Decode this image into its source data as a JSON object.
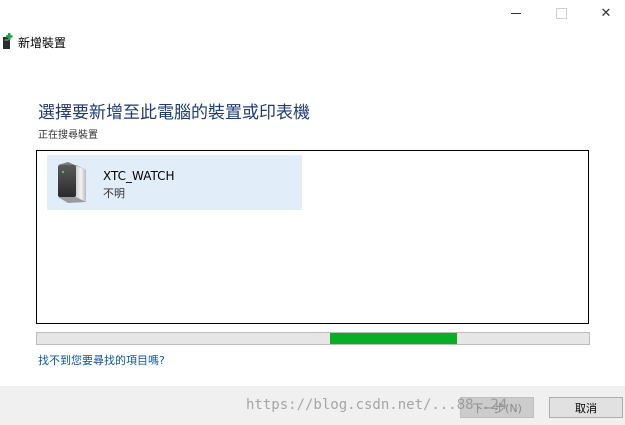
{
  "window": {
    "minimize_icon": "minimize-icon",
    "maximize_icon": "maximize-icon",
    "close_glyph": "✕"
  },
  "header": {
    "title": "新增裝置",
    "icon": "add-device-icon",
    "icon_colors": {
      "device": "#2b2b2b",
      "plus": "#16a84c"
    }
  },
  "main": {
    "heading": "選擇要新增至此電腦的裝置或印表機",
    "status": "正在搜尋裝置",
    "heading_color": "#1e3a78"
  },
  "device_list": {
    "items": [
      {
        "name": "XTC_WATCH",
        "state": "不明",
        "icon": "device-icon",
        "selected": true,
        "highlight_color": "#e1eef9"
      }
    ]
  },
  "progress": {
    "mode": "marquee",
    "segment_start": 0.53,
    "segment_end": 0.76,
    "color": "#06b025"
  },
  "links": {
    "not_found": "找不到您要尋找的項目嗎?"
  },
  "footer": {
    "next_label": "下一步(N)",
    "cancel_label": "取消",
    "next_enabled": false
  },
  "watermark": {
    "text": "https://blog.csdn.net/...88..24"
  }
}
